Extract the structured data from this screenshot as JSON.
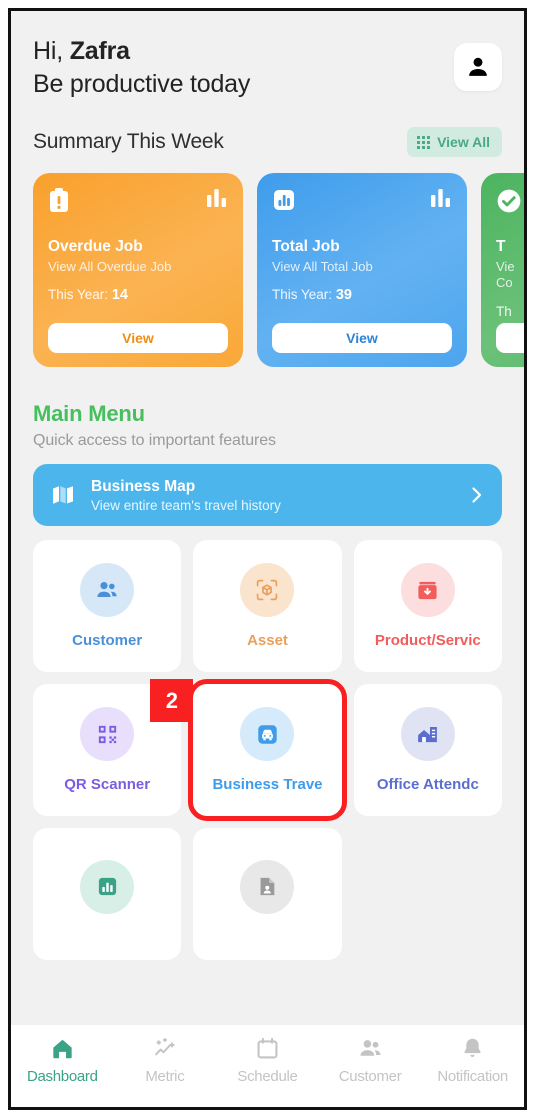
{
  "header": {
    "greeting_prefix": "Hi, ",
    "user_name": "Zafra",
    "tagline": "Be productive today",
    "avatar_icon": "person-icon"
  },
  "summary": {
    "title": "Summary This Week",
    "view_all_label": "View All",
    "view_all_icon": "grid-icon",
    "view_all_bg": "#d2ebe1",
    "view_all_color": "#4aa88a",
    "cards": [
      {
        "id": "overdue-job",
        "title": "Overdue Job",
        "subtitle": "View All Overdue Job",
        "stat_label": "This Year:",
        "stat_value": "14",
        "cta": "View",
        "accent": "#f9a02c",
        "cta_color": "#ef8f14",
        "icon": "clipboard-alert-icon",
        "corner_icon": "bar-chart-icon"
      },
      {
        "id": "total-job",
        "title": "Total Job",
        "subtitle": "View All Total Job",
        "stat_label": "This Year:",
        "stat_value": "39",
        "cta": "View",
        "accent": "#3f9ceb",
        "cta_color": "#2c84d6",
        "icon": "bar-chart-box-icon",
        "corner_icon": "bar-chart-icon"
      },
      {
        "id": "total-completed-job",
        "title": "T",
        "subtitle_line1": "Vie",
        "subtitle_line2": "Co",
        "stat_label": "Th",
        "cta": "",
        "accent": "#4cb45f",
        "cta_color": "#3ba14f",
        "icon": "check-circle-icon",
        "corner_icon": "bar-chart-icon"
      }
    ]
  },
  "main_menu": {
    "title": "Main Menu",
    "title_color": "#48bf5f",
    "subtitle": "Quick access to important features",
    "business_map": {
      "title": "Business Map",
      "subtitle": "View entire team's travel history",
      "icon": "map-icon",
      "chevron_icon": "chevron-right-icon",
      "bg": "#4cb6ec"
    },
    "tiles": [
      {
        "id": "customer",
        "label": "Customer",
        "icon": "people-icon",
        "color": "#4a90d9",
        "bg": "#d6e8f7"
      },
      {
        "id": "asset",
        "label": "Asset",
        "icon": "cube-scan-icon",
        "color": "#e8a05c",
        "bg": "#fae4ce"
      },
      {
        "id": "product-service",
        "label": "Product/Servic",
        "icon": "box-download-icon",
        "color": "#f25c5c",
        "bg": "#fcdede"
      },
      {
        "id": "qr-scanner",
        "label": "QR Scanner",
        "icon": "qr-code-icon",
        "color": "#7c5ce0",
        "bg": "#e7dffb"
      },
      {
        "id": "business-travel",
        "label": "Business Trave",
        "icon": "car-front-icon",
        "color": "#3f9ceb",
        "bg": "#d5eafb",
        "highlighted": true,
        "step": "2"
      },
      {
        "id": "office-attendance",
        "label": "Office Attendc",
        "icon": "office-building-icon",
        "color": "#5a6ed0",
        "bg": "#e0e3f3"
      },
      {
        "id": "report",
        "label": "",
        "icon": "chart-box-icon",
        "color": "#3aa287",
        "bg": "#d8efe8"
      },
      {
        "id": "document",
        "label": "",
        "icon": "document-user-icon",
        "color": "#9a9a9a",
        "bg": "#e8e8e8"
      }
    ]
  },
  "annotation": {
    "step_number": "2",
    "highlight_color": "#f82020"
  },
  "bottom_nav": {
    "active": "Dashboard",
    "items": [
      {
        "label": "Dashboard",
        "icon": "home-icon",
        "active": true
      },
      {
        "label": "Metric",
        "icon": "sparkle-chart-icon",
        "active": false
      },
      {
        "label": "Schedule",
        "icon": "calendar-icon",
        "active": false
      },
      {
        "label": "Customer",
        "icon": "people-icon",
        "active": false
      },
      {
        "label": "Notification",
        "icon": "bell-icon",
        "active": false
      }
    ]
  }
}
